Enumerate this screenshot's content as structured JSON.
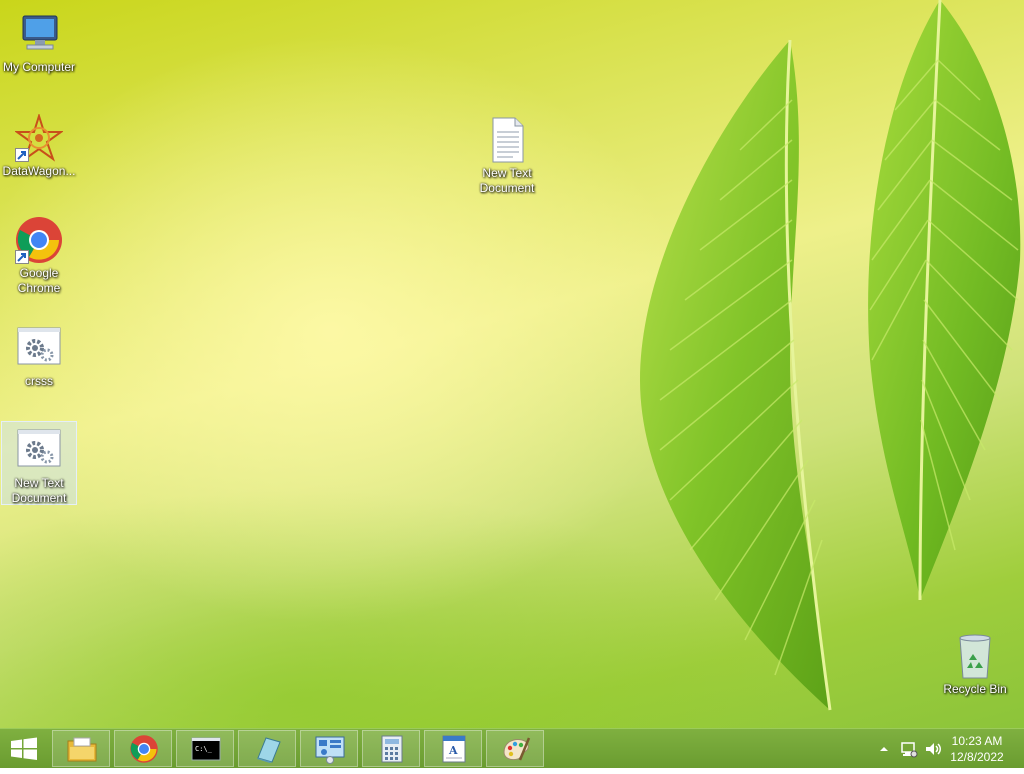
{
  "desktop": {
    "icons": [
      {
        "label": "My Computer",
        "icon": "computer-icon"
      },
      {
        "label": "DataWagon...",
        "icon": "datawagon-icon"
      },
      {
        "label": "Google Chrome",
        "icon": "chrome-icon"
      },
      {
        "label": "crsss",
        "icon": "settings-file-icon"
      },
      {
        "label": "New Text Document",
        "icon": "settings-file-icon"
      },
      {
        "label": "New Text Document",
        "icon": "text-document-icon"
      },
      {
        "label": "Recycle Bin",
        "icon": "recycle-bin-icon"
      }
    ]
  },
  "taskbar": {
    "pinned": [
      {
        "name": "file-explorer",
        "icon": "folder-icon"
      },
      {
        "name": "chrome",
        "icon": "chrome-icon"
      },
      {
        "name": "command-prompt",
        "icon": "terminal-icon",
        "glyph": "C:\\_"
      },
      {
        "name": "notebook",
        "icon": "notebook-icon"
      },
      {
        "name": "control-panel",
        "icon": "control-panel-icon"
      },
      {
        "name": "calculator",
        "icon": "calculator-icon"
      },
      {
        "name": "wordpad",
        "icon": "wordpad-icon",
        "glyph": "A"
      },
      {
        "name": "paint",
        "icon": "paint-icon"
      }
    ],
    "tray": {
      "time": "10:23 AM",
      "date": "12/8/2022"
    }
  }
}
